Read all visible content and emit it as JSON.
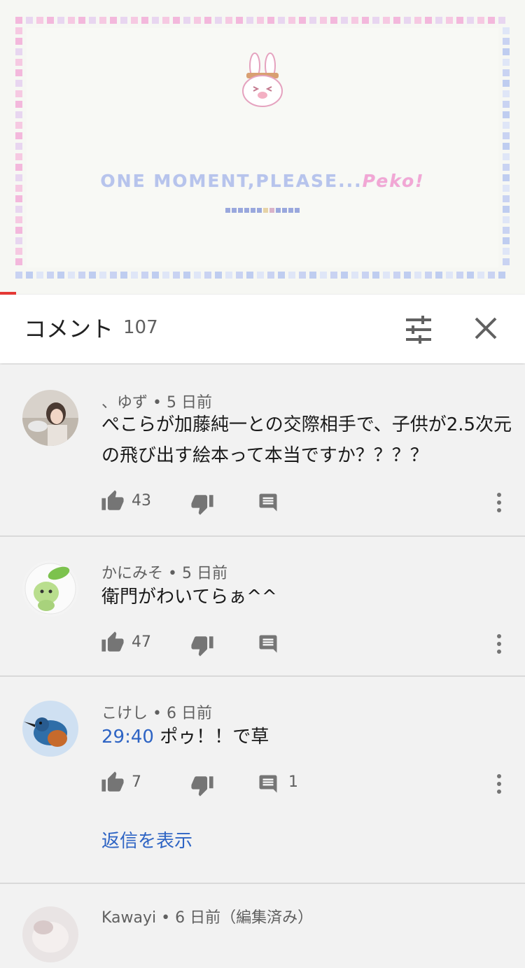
{
  "video": {
    "loading_text_main": "ONE MOMENT,PLEASE...",
    "loading_text_sig": "Peko!",
    "progress_fraction": 0.03
  },
  "header": {
    "title": "コメント",
    "count": "107"
  },
  "comments": [
    {
      "author": "、ゆず",
      "time": "5 日前",
      "text": "ぺこらが加藤純一との交際相手で、子供が2.5次元の飛び出す絵本って本当ですか？？？？",
      "likes": "43",
      "replies": ""
    },
    {
      "author": "かにみそ",
      "time": "5 日前",
      "text": "衛門がわいてらぁ^^",
      "likes": "47",
      "replies": ""
    },
    {
      "author": "こけし",
      "time": "6 日前",
      "timestamp_link": "29:40",
      "text": "ポゥ！！で草",
      "likes": "7",
      "replies": "1",
      "show_replies": "返信を表示"
    },
    {
      "author": "Kawayi",
      "time": "6 日前（編集済み）"
    }
  ],
  "icons": {
    "like": "thumb-up-icon",
    "dislike": "thumb-down-icon",
    "reply": "comment-icon",
    "more": "more-vertical-icon",
    "sort": "sort-filter-icon",
    "close": "close-icon"
  },
  "colors": {
    "link": "#2e64c4",
    "progress": "#e53935"
  }
}
